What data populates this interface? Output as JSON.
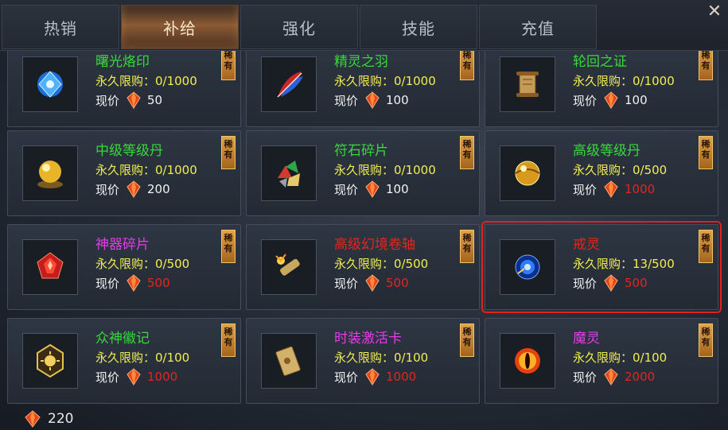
{
  "tabs": [
    {
      "label": "热销",
      "active": false
    },
    {
      "label": "补给",
      "active": true
    },
    {
      "label": "强化",
      "active": false
    },
    {
      "label": "技能",
      "active": false
    },
    {
      "label": "充值",
      "active": false
    }
  ],
  "close_icon": "close-icon",
  "rare_badge": "稀有",
  "price_label": "现价",
  "items": [
    {
      "name": "曙光烙印",
      "name_color": "#37d83a",
      "limit": "永久限购：0/1000",
      "price": "50",
      "price_color": "#f2f2f2",
      "icon": "blue-crystal-icon",
      "selected": false
    },
    {
      "name": "精灵之羽",
      "name_color": "#37d83a",
      "limit": "永久限购：0/1000",
      "price": "100",
      "price_color": "#f2f2f2",
      "icon": "feather-icon",
      "selected": false
    },
    {
      "name": "轮回之证",
      "name_color": "#37d83a",
      "limit": "永久限购：0/1000",
      "price": "100",
      "price_color": "#f2f2f2",
      "icon": "scroll-icon",
      "selected": false
    },
    {
      "name": "中级等级丹",
      "name_color": "#37d83a",
      "limit": "永久限购：0/1000",
      "price": "200",
      "price_color": "#f2f2f2",
      "icon": "golden-orb-icon",
      "selected": false
    },
    {
      "name": "符石碎片",
      "name_color": "#37d83a",
      "limit": "永久限购：0/1000",
      "price": "100",
      "price_color": "#f2f2f2",
      "icon": "rune-shards-icon",
      "selected": false
    },
    {
      "name": "高级等级丹",
      "name_color": "#37d83a",
      "limit": "永久限购：0/500",
      "price": "1000",
      "price_color": "#e2261f",
      "icon": "golden-sphere-icon",
      "selected": false
    },
    {
      "name": "神器碎片",
      "name_color": "#e23de6",
      "limit": "永久限购：0/500",
      "price": "500",
      "price_color": "#e2261f",
      "icon": "red-gem-icon",
      "selected": false
    },
    {
      "name": "高级幻境卷轴",
      "name_color": "#e2261f",
      "limit": "永久限购：0/500",
      "price": "500",
      "price_color": "#e2261f",
      "icon": "magic-scroll-icon",
      "selected": false
    },
    {
      "name": "戒灵",
      "name_color": "#e2261f",
      "limit": "永久限购：13/500",
      "price": "500",
      "price_color": "#e2261f",
      "icon": "blue-vortex-icon",
      "selected": true
    },
    {
      "name": "众神徽记",
      "name_color": "#37d83a",
      "limit": "永久限购：0/100",
      "price": "1000",
      "price_color": "#e2261f",
      "icon": "sun-emblem-icon",
      "selected": false
    },
    {
      "name": "时装激活卡",
      "name_color": "#e23de6",
      "limit": "永久限购：0/100",
      "price": "1000",
      "price_color": "#e2261f",
      "icon": "card-icon",
      "selected": false
    },
    {
      "name": "魔灵",
      "name_color": "#e23de6",
      "limit": "永久限购：0/100",
      "price": "2000",
      "price_color": "#e2261f",
      "icon": "fire-eye-icon",
      "selected": false
    }
  ],
  "balance": {
    "value": "220",
    "icon": "red-diamond-icon"
  }
}
